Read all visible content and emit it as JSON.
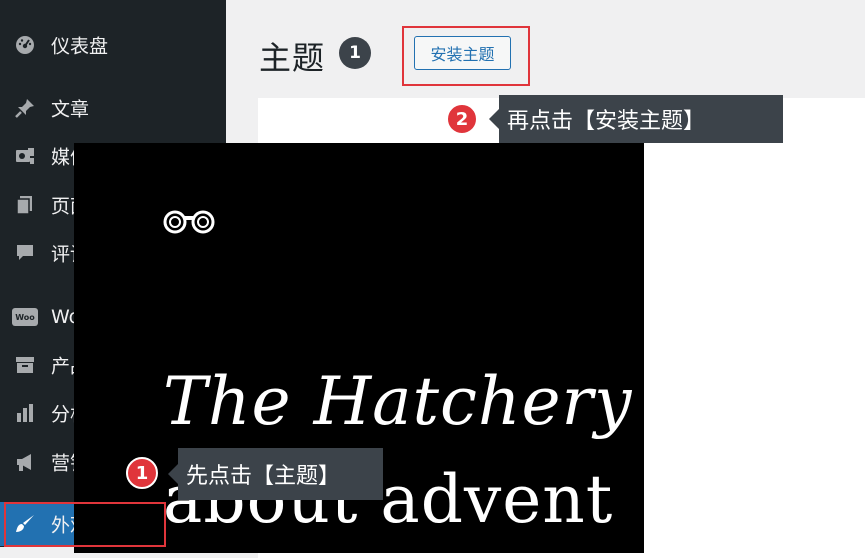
{
  "sidebar": {
    "items": [
      {
        "label": "仪表盘",
        "icon": "dashboard-icon"
      },
      {
        "label": "文章",
        "icon": "pin-icon"
      },
      {
        "label": "媒体",
        "icon": "media-icon"
      },
      {
        "label": "页面",
        "icon": "pages-icon"
      },
      {
        "label": "评论",
        "icon": "comments-icon"
      },
      {
        "label": "WooCommerce",
        "icon": "woo-icon",
        "badge": "Woo"
      },
      {
        "label": "产品",
        "icon": "archive-icon"
      },
      {
        "label": "分析",
        "icon": "chart-bar-icon"
      },
      {
        "label": "营销",
        "icon": "megaphone-icon"
      },
      {
        "label": "外观",
        "icon": "brush-icon",
        "active": true
      }
    ]
  },
  "main": {
    "title": "主题",
    "count": "1",
    "install_button": "安装主题"
  },
  "theme_preview": {
    "line1": "The Hatchery",
    "line2": "about advent"
  },
  "annotations": {
    "step1": {
      "number": "1",
      "text": "先点击【主题】"
    },
    "step2": {
      "number": "2",
      "text": "再点击【安装主题】"
    }
  },
  "colors": {
    "sidebar_bg": "#1d2327",
    "active_bg": "#2271b1",
    "highlight_red": "#e0353b",
    "tooltip_bg": "#3c434a"
  }
}
